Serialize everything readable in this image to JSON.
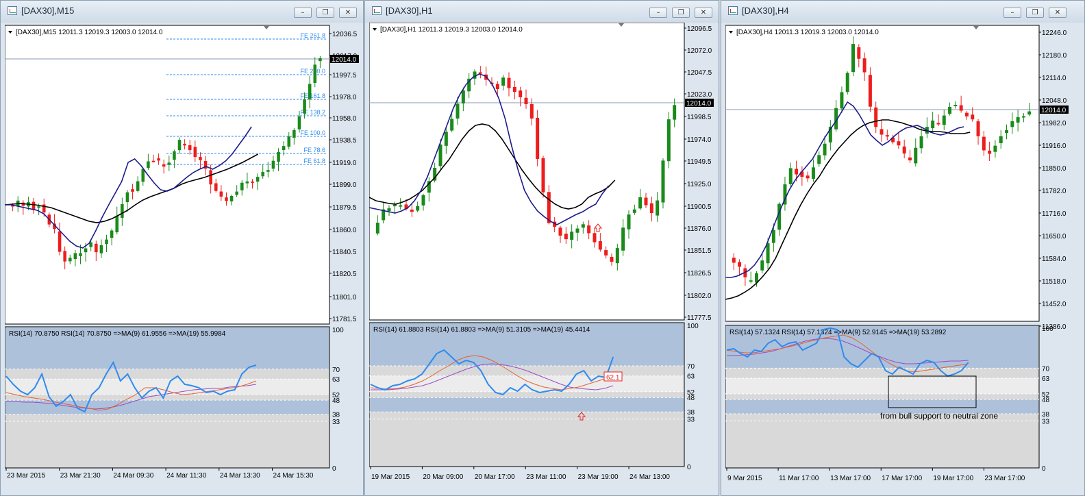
{
  "windows": [
    {
      "title": "[DAX30],M15",
      "header": "[DAX30],M15  12011.3 12019.3 12003.0 12014.0",
      "price_label": "12014.0",
      "price_levels": [
        "12036.5",
        "12017.0",
        "11997.5",
        "11978.0",
        "11958.0",
        "11938.5",
        "11919.0",
        "11899.0",
        "11879.5",
        "11860.0",
        "11840.5",
        "11820.5",
        "11801.0",
        "11781.5"
      ],
      "fib_labels": [
        "FE 261.8",
        "FE 200.0",
        "FE 161.8",
        "FE 138.2",
        "FE 100.0",
        "FE 78.6",
        "FE 61.8"
      ],
      "rsi_header": "RSI(14) 70.8750  RSI(14) 70.8750  =>MA(9) 61.9556  =>MA(19) 55.9984",
      "rsi_levels": [
        "100",
        "70",
        "63",
        "52",
        "48",
        "38",
        "33",
        "0"
      ],
      "time_labels": [
        "23 Mar 2015",
        "23 Mar 21:30",
        "24 Mar 09:30",
        "24 Mar 11:30",
        "24 Mar 13:30",
        "24 Mar 15:30"
      ]
    },
    {
      "title": "[DAX30],H1",
      "header": "[DAX30],H1  12011.3 12019.3 12003.0 12014.0",
      "price_label": "12014.0",
      "price_levels": [
        "12096.5",
        "12072.0",
        "12047.5",
        "12023.0",
        "11998.5",
        "11974.0",
        "11949.5",
        "11925.0",
        "11900.5",
        "11876.0",
        "11851.5",
        "11826.5",
        "11802.0",
        "11777.5"
      ],
      "rsi_header": "RSI(14) 61.8803  RSI(14) 61.8803  =>MA(9) 51.3105  =>MA(19) 45.4414",
      "rsi_levels": [
        "100",
        "70",
        "63",
        "52",
        "48",
        "38",
        "33",
        "0"
      ],
      "rsi_value_label": "62.1",
      "time_labels": [
        "19 Mar 2015",
        "20 Mar 09:00",
        "20 Mar 17:00",
        "23 Mar 11:00",
        "23 Mar 19:00",
        "24 Mar 13:00"
      ]
    },
    {
      "title": "[DAX30],H4",
      "header": "[DAX30],H4  12011.3 12019.3 12003.0 12014.0",
      "price_label": "12014.0",
      "price_levels": [
        "12246.0",
        "12180.0",
        "12114.0",
        "12048.0",
        "11982.0",
        "11916.0",
        "11850.0",
        "11782.0",
        "11716.0",
        "11650.0",
        "11584.0",
        "11518.0",
        "11452.0",
        "11386.0"
      ],
      "rsi_header": "RSI(14) 57.1324  RSI(14) 57.1324  =>MA(9) 52.9145  =>MA(19) 53.2892",
      "rsi_levels": [
        "100",
        "70",
        "63",
        "52",
        "48",
        "38",
        "33",
        "0"
      ],
      "annotation": "from bull support to neutral zone",
      "time_labels": [
        "9 Mar 2015",
        "11 Mar 17:00",
        "13 Mar 17:00",
        "17 Mar 17:00",
        "19 Mar 17:00",
        "23 Mar 17:00"
      ]
    }
  ],
  "controls": {
    "minimize": "–",
    "restore": "❐",
    "close": "✕"
  },
  "colors": {
    "bull": "#1a8a1a",
    "bear": "#ee1c1c",
    "ma_fast": "#1c1c8c",
    "ma_slow": "#000000",
    "rsi": "#2e8bef",
    "rsi_ma9": "#e8602c",
    "rsi_ma19": "#9a4cc8",
    "fib": "#2e8bef",
    "rsi_band": "#aec1da",
    "rsi_neutral": "#d9d9d9"
  }
}
